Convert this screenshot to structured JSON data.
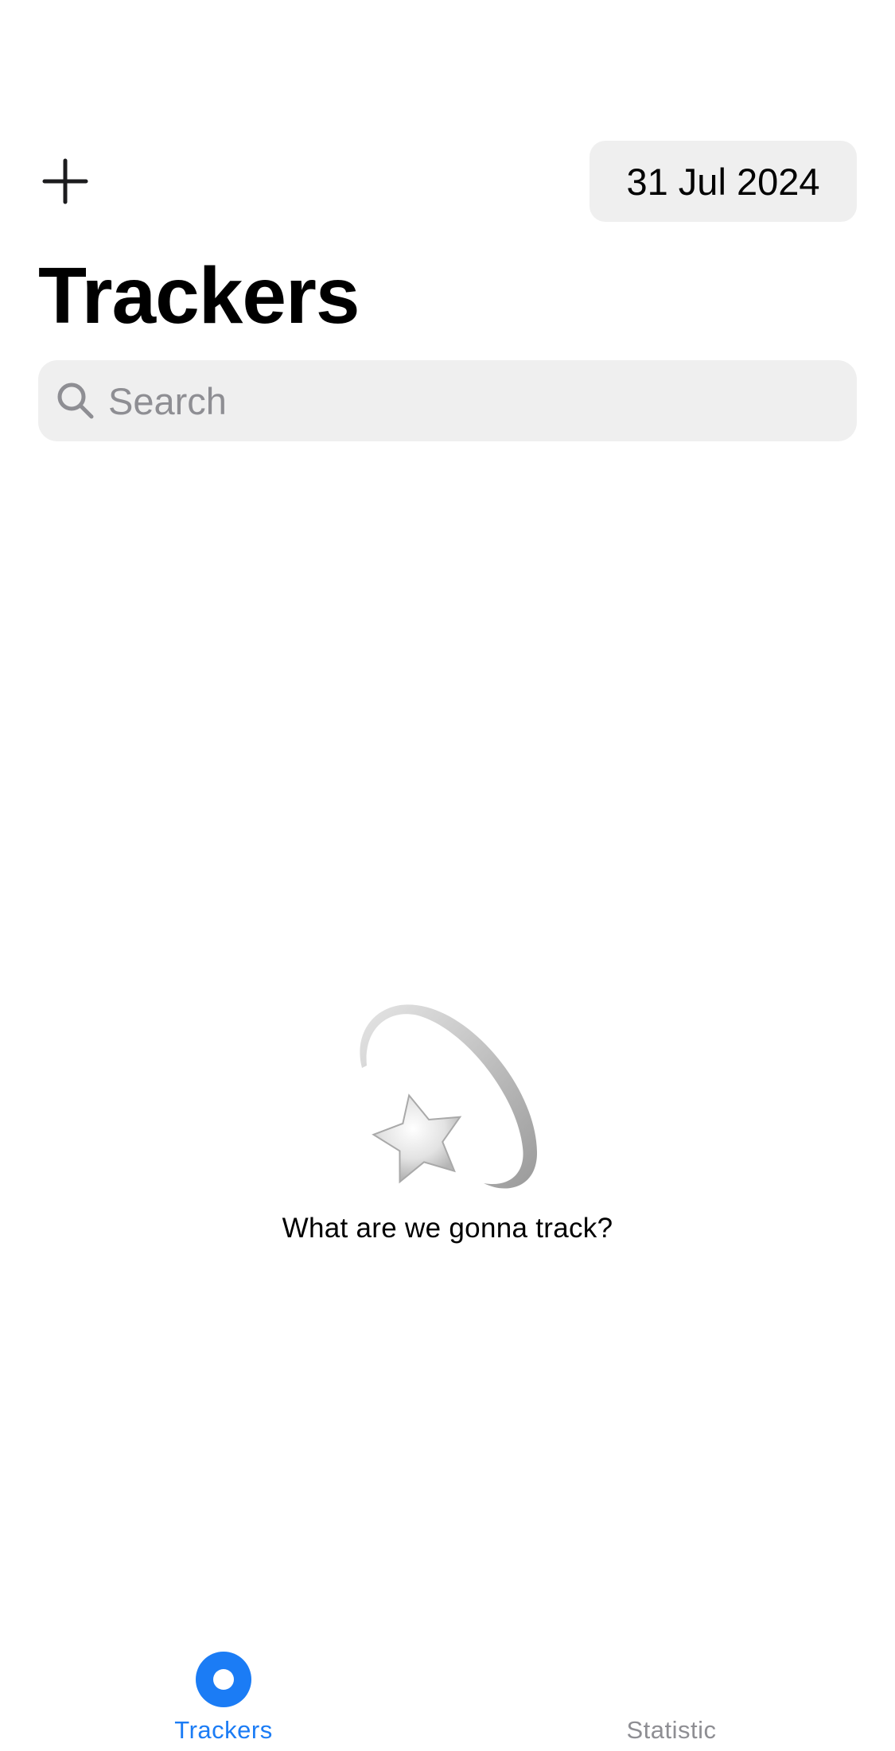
{
  "header": {
    "add_icon": "plus-icon",
    "date_label": "31 Jul 2024",
    "title": "Trackers"
  },
  "search": {
    "placeholder": "Search",
    "value": "",
    "icon": "magnifying-glass-icon"
  },
  "empty_state": {
    "icon": "shooting-star-icon",
    "message": "What are we gonna track?"
  },
  "tab_bar": {
    "tabs": [
      {
        "label": "Trackers",
        "icon": "trackers-circle-icon",
        "selected": true
      },
      {
        "label": "Statistic",
        "icon": "statistic-icon",
        "selected": false
      }
    ]
  },
  "colors": {
    "accent": "#1b7cf5",
    "inactive": "#8e8e93",
    "control_background": "#efefef",
    "text": "#000000",
    "background": "#ffffff"
  }
}
